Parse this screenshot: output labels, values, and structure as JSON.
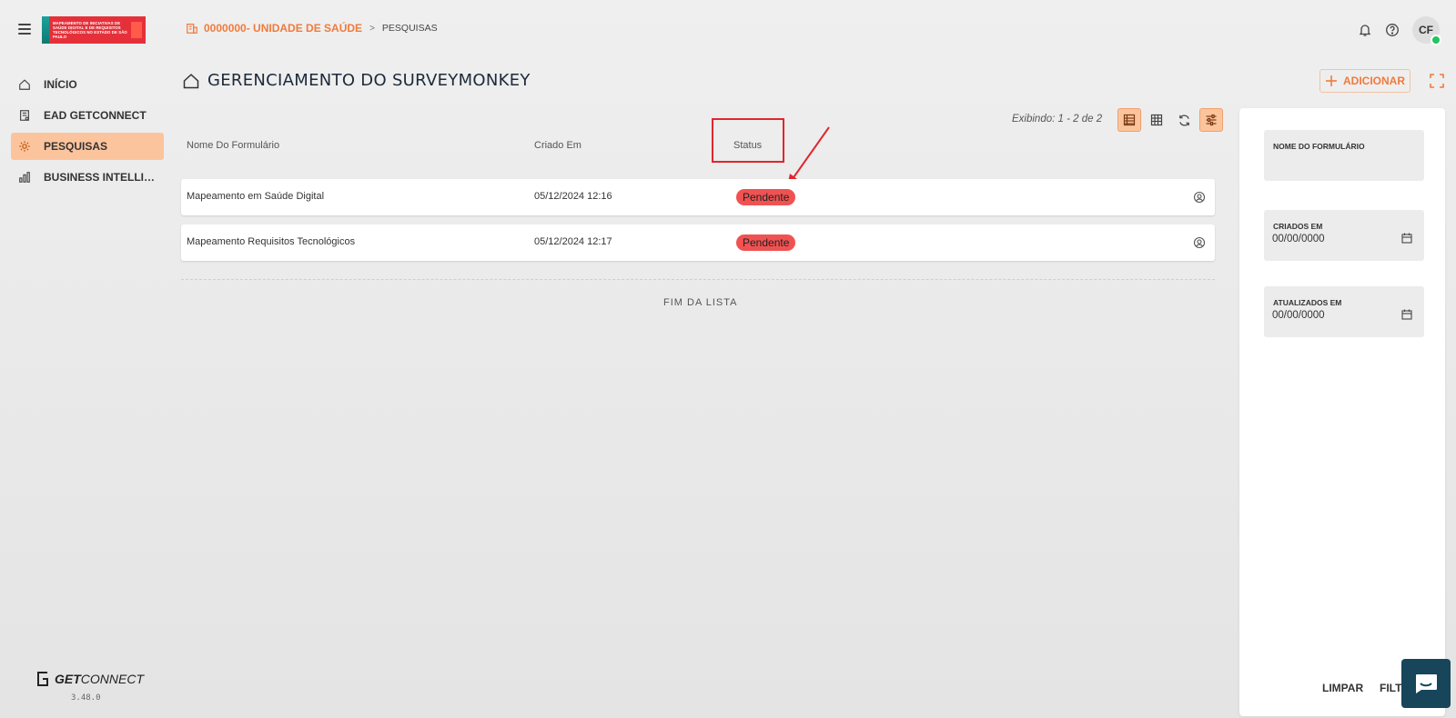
{
  "header": {
    "logo_text": "MAPEAMENTO DE INICIATIVAS DE SAÚDE DIGITAL E DE REQUISITOS TECNOLÓGICOS NO ESTADO DE SÃO PAULO",
    "breadcrumb": {
      "home": "0000000- UNIDADE DE SAÚDE",
      "separator": ">",
      "current": "PESQUISAS"
    },
    "avatar_initials": "CF"
  },
  "sidebar": {
    "items": [
      {
        "label": "INÍCIO",
        "icon": "home-icon"
      },
      {
        "label": "EAD GETCONNECT",
        "icon": "book-icon"
      },
      {
        "label": "PESQUISAS",
        "icon": "gear-icon"
      },
      {
        "label": "BUSINESS INTELLI…",
        "icon": "chart-icon"
      }
    ],
    "brand": {
      "bold": "GET",
      "rest": "CONNECT"
    },
    "version": "3.48.0"
  },
  "main": {
    "title": "GERENCIAMENTO DO SURVEYMONKEY",
    "add_label": "ADICIONAR",
    "showing": "Exibindo: 1 - 2 de 2",
    "columns": {
      "name": "Nome Do Formulário",
      "created": "Criado Em",
      "status": "Status"
    },
    "rows": [
      {
        "name": "Mapeamento em Saúde Digital",
        "created": "05/12/2024 12:16",
        "status": "Pendente"
      },
      {
        "name": "Mapeamento Requisitos Tecnológicos",
        "created": "05/12/2024 12:17",
        "status": "Pendente"
      }
    ],
    "end_of_list": "FIM DA LISTA"
  },
  "filters": {
    "name_label": "NOME DO FORMULÁRIO",
    "created_label": "CRIADOS EM",
    "created_value": "00/00/0000",
    "updated_label": "ATUALIZADOS EM",
    "updated_value": "00/00/0000",
    "clear_label": "LIMPAR",
    "filter_label": "FILTRAR"
  },
  "colors": {
    "accent": "#f07a3c",
    "active_nav": "#fcc49d",
    "status_pending": "#f05252",
    "annotation": "#e0262d",
    "chat": "#17455a"
  }
}
